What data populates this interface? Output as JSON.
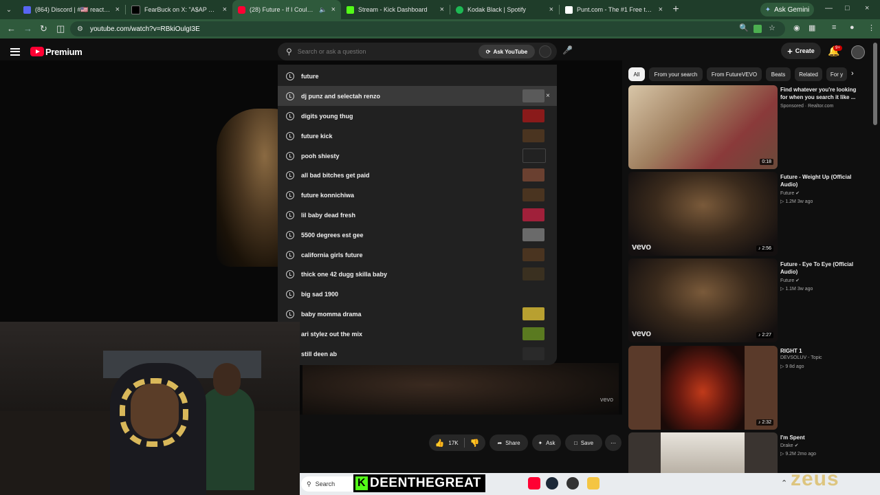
{
  "browser": {
    "tabs": [
      {
        "title": "(864) Discord | #🇺🇸 reactions",
        "color": "#5865f2"
      },
      {
        "title": "FearBuck on X: \"A$AP Rocky gi",
        "color": "#000000"
      },
      {
        "title": "(28) Future - If I Could (Offi",
        "color": "#ff0033"
      },
      {
        "title": "Stream - Kick Dashboard",
        "color": "#53fc18"
      },
      {
        "title": "Kodak Black | Spotify",
        "color": "#1db954"
      },
      {
        "title": "Punt.com - The #1 Free to Play",
        "color": "#ffffff"
      }
    ],
    "gemini_label": "Ask Gemini",
    "url": "youtube.com/watch?v=RBkiOulgI3E"
  },
  "youtube": {
    "premium_label": "Premium",
    "search_placeholder": "Search or ask a question",
    "ask_youtube_label": "Ask YouTube",
    "create_label": "Create",
    "notif_badge": "9+",
    "suggestions": [
      {
        "text": "future",
        "thumb": ""
      },
      {
        "text": "dj punz and selectah renzo",
        "thumb": "#5a5a5a"
      },
      {
        "text": "digits young thug",
        "thumb": "#8a1a1a"
      },
      {
        "text": "future kick",
        "thumb": "#4a3420"
      },
      {
        "text": "pooh shiesty",
        "thumb": "#222222"
      },
      {
        "text": "all bad bitches get paid",
        "thumb": "#6a4030"
      },
      {
        "text": "future konnichiwa",
        "thumb": "#4a3420"
      },
      {
        "text": "lil baby dead fresh",
        "thumb": "#a0203a"
      },
      {
        "text": "5500 degrees est gee",
        "thumb": "#6a6a6a"
      },
      {
        "text": "california girls future",
        "thumb": "#4a3420"
      },
      {
        "text": "thick one 42 dugg skilla baby",
        "thumb": "#3a3020"
      },
      {
        "text": "big sad 1900",
        "thumb": ""
      },
      {
        "text": "baby momma drama",
        "thumb": "#b8a030"
      },
      {
        "text": "ari stylez out the mix",
        "thumb": "#5a7a20"
      },
      {
        "text": "still deen ab",
        "thumb": "#2a2a2a"
      }
    ],
    "chips": [
      "All",
      "From your search",
      "From FutureVEVO",
      "Beats",
      "Related",
      "For y"
    ],
    "recs": [
      {
        "title": "Find whatever you're looking for when you search it like ...",
        "meta1": "Sponsored · Realtor.com",
        "meta2": "",
        "duration": "0:18",
        "vevo": ""
      },
      {
        "title": "Future - Weight Up (Official Audio)",
        "meta1": "Future ✔",
        "meta2": "▷ 1.2M  3w ago",
        "duration": "♪ 2:56",
        "vevo": "vevo"
      },
      {
        "title": "Future - Eye To Eye (Official Audio)",
        "meta1": "Future ✔",
        "meta2": "▷ 1.1M  3w ago",
        "duration": "♪ 2:27",
        "vevo": "vevo"
      },
      {
        "title": "RIGHT 1",
        "meta1": "DEVSOLUV - Topic",
        "meta2": "▷ 9  8d ago",
        "duration": "♪ 2:32",
        "vevo": ""
      },
      {
        "title": "I'm Spent",
        "meta1": "Drake ✔",
        "meta2": "▷ 9.2M  2mo ago",
        "duration": "",
        "vevo": ""
      }
    ],
    "actions": {
      "likes": "17K",
      "share": "Share",
      "ask": "Ask",
      "save": "Save"
    },
    "video_watermark": "vevo"
  },
  "stream_overlay": {
    "name": "DEENTHEGREAT",
    "k": "K",
    "watermark": "zeus"
  },
  "taskbar": {
    "search_label": "Search"
  },
  "colors": {
    "chrome_green": "#2f5a3c",
    "yt_red": "#ff0033",
    "kick_green": "#53fc18"
  }
}
